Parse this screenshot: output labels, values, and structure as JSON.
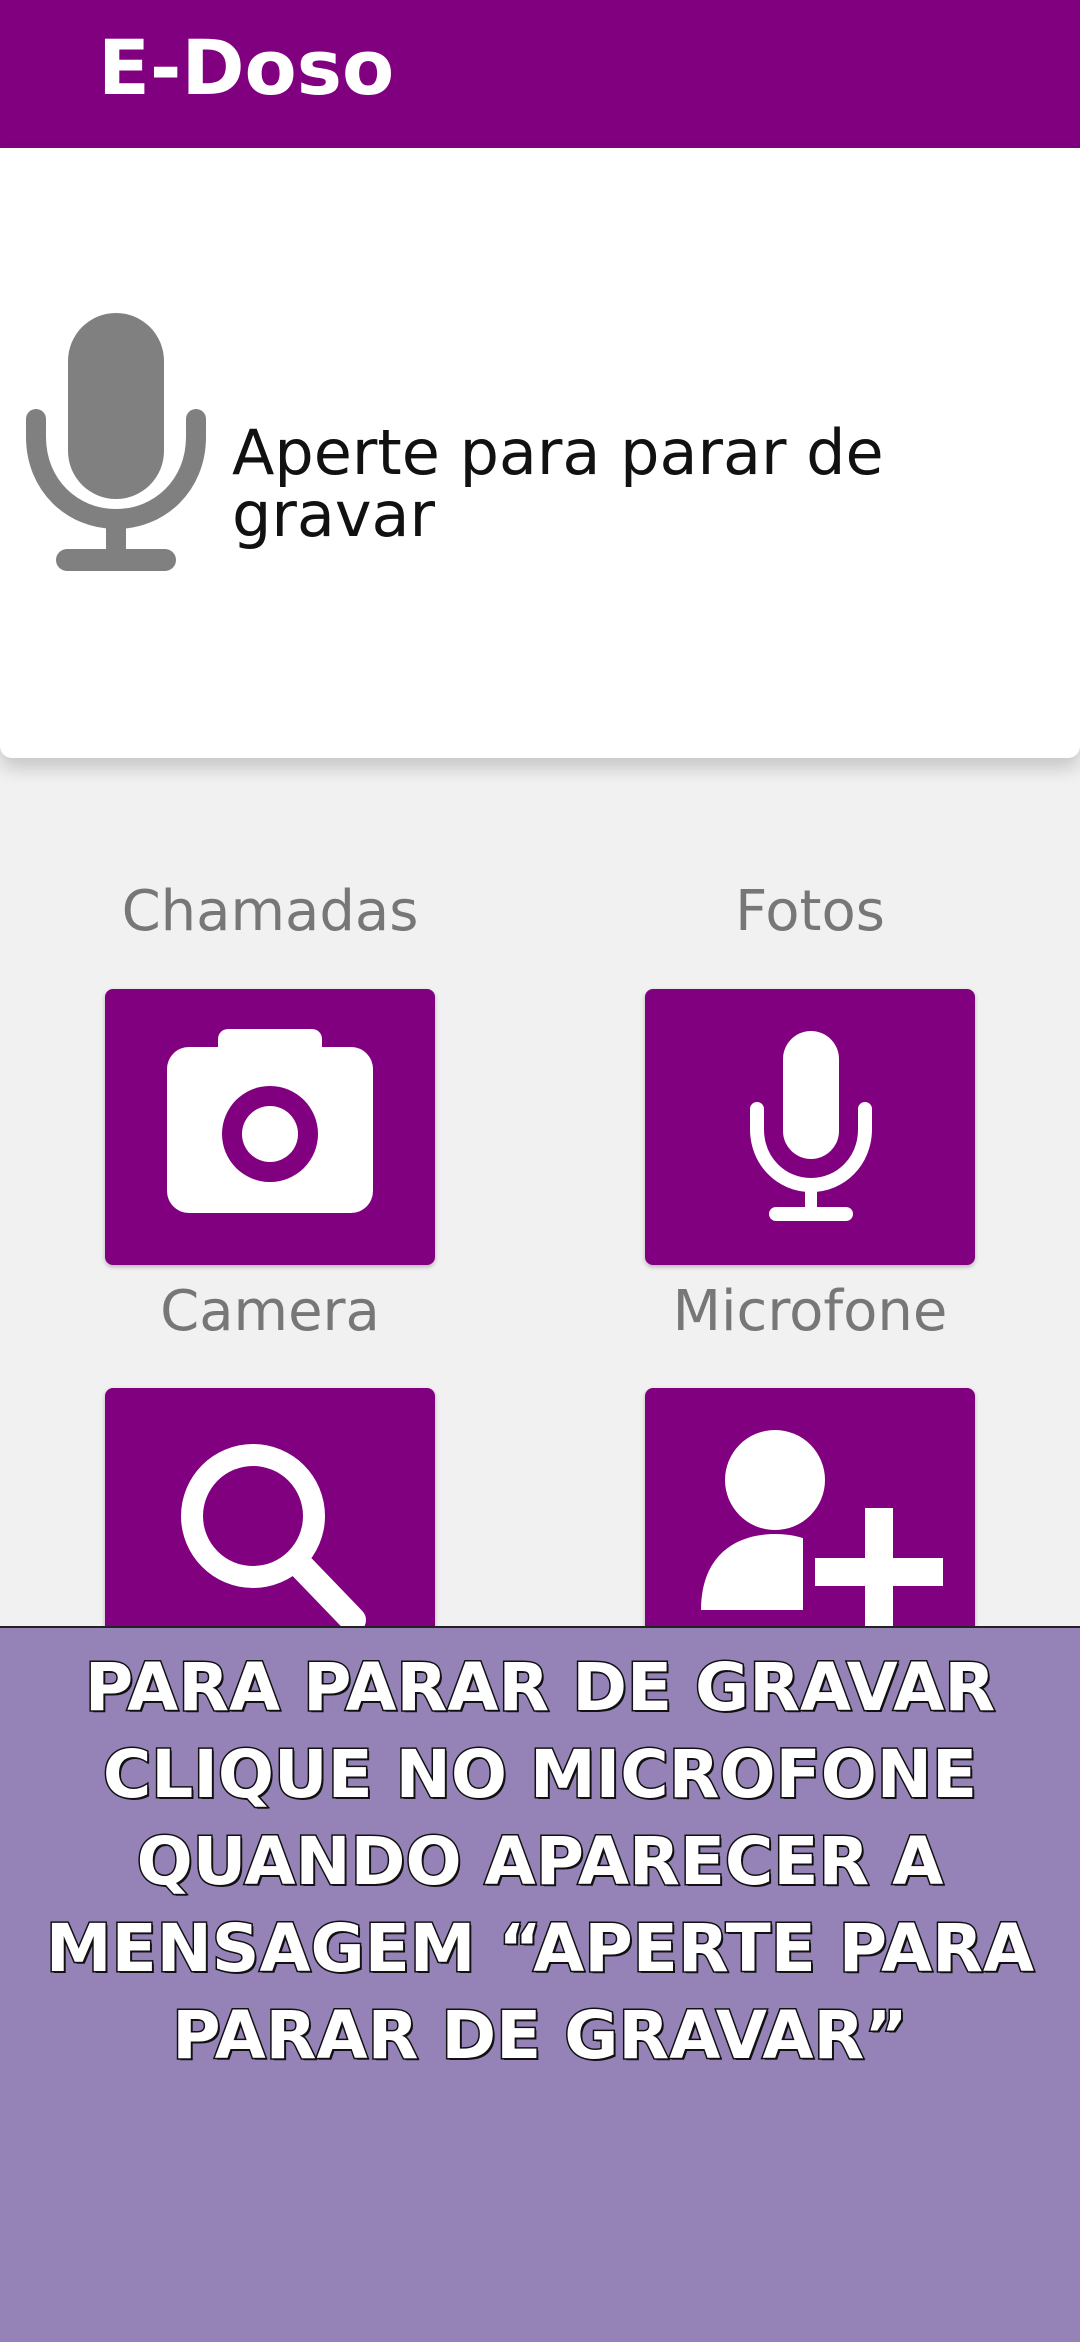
{
  "colors": {
    "primary": "#800080",
    "overlay": "#9583b8",
    "icon_gray": "#808080"
  },
  "app": {
    "title": "E-Doso"
  },
  "grid": {
    "tiles": [
      {
        "label": "Chamadas",
        "icon": "phone-icon"
      },
      {
        "label": "Fotos",
        "icon": "photo-icon"
      },
      {
        "label": "Camera",
        "icon": "camera-icon"
      },
      {
        "label": "Microfone",
        "icon": "microphone-icon"
      },
      {
        "label": "",
        "icon": "search-icon"
      },
      {
        "label": "",
        "icon": "add-contact-icon"
      }
    ]
  },
  "dialog": {
    "icon": "microphone-icon",
    "message": "Aperte para parar de gravar"
  },
  "overlay": {
    "lines": [
      "PARA PARAR DE GRAVAR",
      "CLIQUE NO MICROFONE",
      "QUANDO APARECER A",
      "MENSAGEM “APERTE PARA",
      "PARAR DE GRAVAR”"
    ]
  }
}
